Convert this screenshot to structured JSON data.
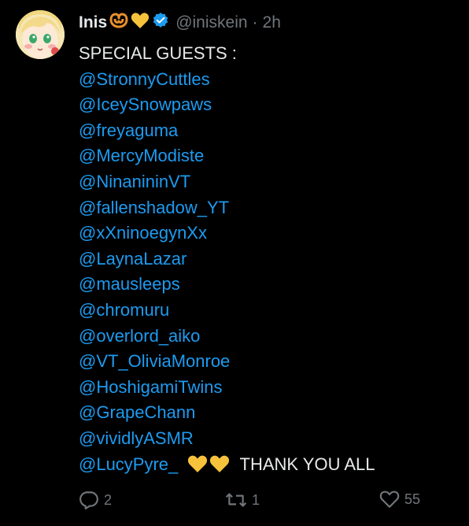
{
  "author": {
    "name": "Inis",
    "handle": "@iniskein",
    "separator": "·",
    "time": "2h",
    "name_emoji": [
      "pretzel-icon",
      "yellow-heart-icon"
    ],
    "verified": true,
    "verified_color": "#1d9bf0"
  },
  "tweet": {
    "intro": "SPECIAL GUESTS :",
    "mentions": [
      "@StronnyCuttles",
      "@IceySnowpaws",
      "@freyaguma",
      "@MercyModiste",
      "@NinanininVT",
      "@fallenshadow_YT",
      "@xXninoegynXx",
      "@LaynaLazar",
      "@mausleeps",
      "@chromuru",
      "@overlord_aiko",
      "@VT_OliviaMonroe",
      "@HoshigamiTwins",
      "@GrapeChann",
      "@vividlyASMR",
      "@LucyPyre_"
    ],
    "closing": "THANK YOU ALL",
    "mention_color": "#1d9bf0"
  },
  "actions": {
    "replies": "2",
    "retweets": "1",
    "likes": "55"
  },
  "colors": {
    "background": "#000000",
    "text": "#e7e9ea",
    "muted": "#71767b",
    "heart": "#f7c23b"
  }
}
